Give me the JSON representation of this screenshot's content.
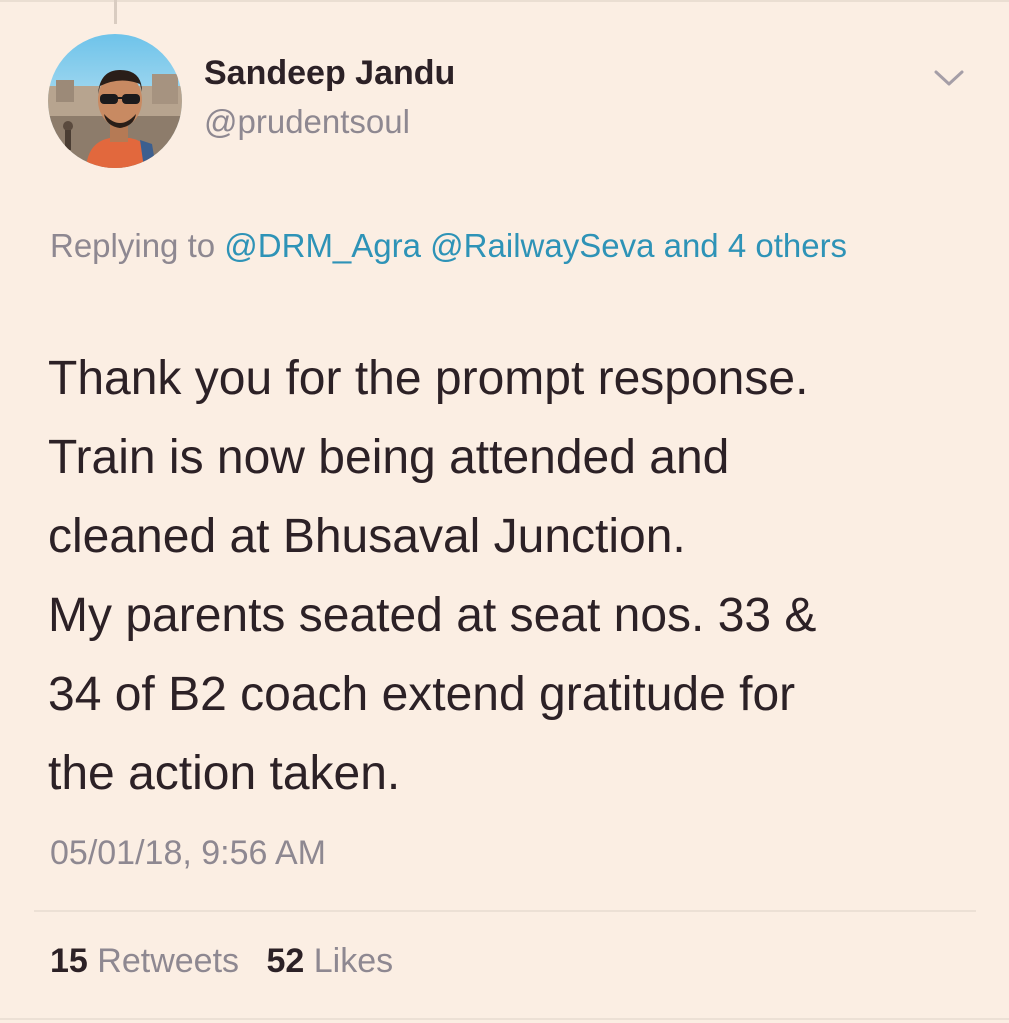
{
  "tweet": {
    "author": {
      "display_name": "Sandeep Jandu",
      "handle": "@prudentsoul",
      "avatar_icon": "user-avatar-photo"
    },
    "menu_icon": "chevron-down-icon",
    "reply_context": {
      "prefix": "Replying to",
      "mentions": [
        "@DRM_Agra",
        "@RailwaySeva"
      ],
      "others_text": "and 4 others"
    },
    "text_lines": [
      "Thank you for the prompt response.",
      "Train is now being attended and",
      "cleaned at Bhusaval Junction.",
      "My parents seated at seat nos. 33 &",
      "34 of B2 coach extend gratitude for",
      "the action taken."
    ],
    "timestamp": "05/01/18, 9:56 AM",
    "stats": {
      "retweets_count": "15",
      "retweets_label": "Retweets",
      "likes_count": "52",
      "likes_label": "Likes"
    }
  },
  "colors": {
    "background": "#fbeee3",
    "text_primary": "#2c2126",
    "text_secondary": "#8e8891",
    "link": "#2e93b7"
  }
}
